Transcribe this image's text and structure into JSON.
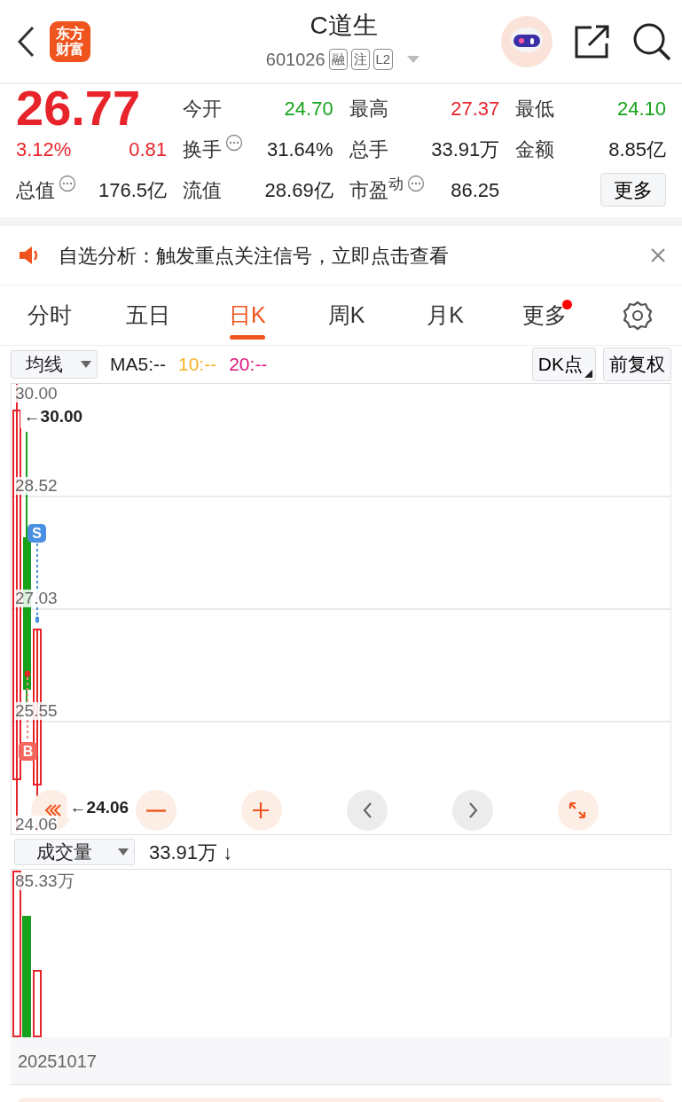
{
  "header": {
    "logo": [
      "东方",
      "财富"
    ],
    "title": "C道生",
    "code": "601026",
    "badges": [
      "融",
      "注",
      "L2"
    ]
  },
  "quote": {
    "price": "26.77",
    "change_pct": "3.12%",
    "change": "0.81",
    "color": "#e8242b",
    "left_stat": {
      "label": "总值",
      "info": true,
      "value": "176.5亿",
      "color": "#222222"
    },
    "rows": [
      [
        {
          "label": "今开",
          "info": false,
          "value": "24.70",
          "color": "#16a31b"
        },
        {
          "label": "最高",
          "info": false,
          "value": "27.37",
          "color": "#e8242b"
        },
        {
          "label": "最低",
          "info": false,
          "value": "24.10",
          "color": "#16a31b"
        }
      ],
      [
        {
          "label": "换手",
          "info": true,
          "value": "31.64%",
          "color": "#222222"
        },
        {
          "label": "总手",
          "info": false,
          "value": "33.91万",
          "color": "#222222"
        },
        {
          "label": "金额",
          "info": false,
          "value": "8.85亿",
          "color": "#222222"
        }
      ],
      [
        {
          "label": "流值",
          "info": false,
          "value": "28.69亿",
          "color": "#222222"
        },
        {
          "label": "市盈$^{动}$",
          "info": true,
          "value": "86.25",
          "color": "#222222"
        }
      ]
    ],
    "more_button": "更多"
  },
  "notice": {
    "text": "自选分析：触发重点关注信号，立即点击查看"
  },
  "tabs": [
    {
      "label": "分时",
      "selected": false,
      "dot": false
    },
    {
      "label": "五日",
      "selected": false,
      "dot": false
    },
    {
      "label": "日K",
      "selected": true,
      "dot": false
    },
    {
      "label": "周K",
      "selected": false,
      "dot": false
    },
    {
      "label": "月K",
      "selected": false,
      "dot": false
    },
    {
      "label": "更多",
      "selected": false,
      "dot": true
    }
  ],
  "toolbar": {
    "indicator": "均线",
    "ma": [
      {
        "text": "MA5:--",
        "color": "#222222"
      },
      {
        "text": "10:--",
        "color": "#f5b428"
      },
      {
        "text": "20:--",
        "color": "#e0177f"
      }
    ],
    "buttons": [
      {
        "label": "DK点",
        "corner": true
      },
      {
        "label": "前复权",
        "corner": false
      }
    ]
  },
  "chart": {
    "y_labels": [
      "30.00",
      "28.52",
      "27.03",
      "25.55",
      "24.06"
    ],
    "max_mark": "←30.00",
    "min_mark": "←24.06",
    "signals": [
      {
        "kind": "sell",
        "text": "S"
      },
      {
        "kind": "buy",
        "text": "B"
      }
    ],
    "controls": [
      {
        "kind": "rewind",
        "disabled": false
      },
      {
        "kind": "zoom_out",
        "disabled": false
      },
      {
        "kind": "zoom_in",
        "disabled": false
      },
      {
        "kind": "prev",
        "disabled": true
      },
      {
        "kind": "next",
        "disabled": true
      },
      {
        "kind": "expand",
        "disabled": false
      }
    ]
  },
  "volume": {
    "indicator": "成交量",
    "reading": "33.91万 ↓",
    "max_label": "85.33万",
    "date": "20251017"
  }
}
